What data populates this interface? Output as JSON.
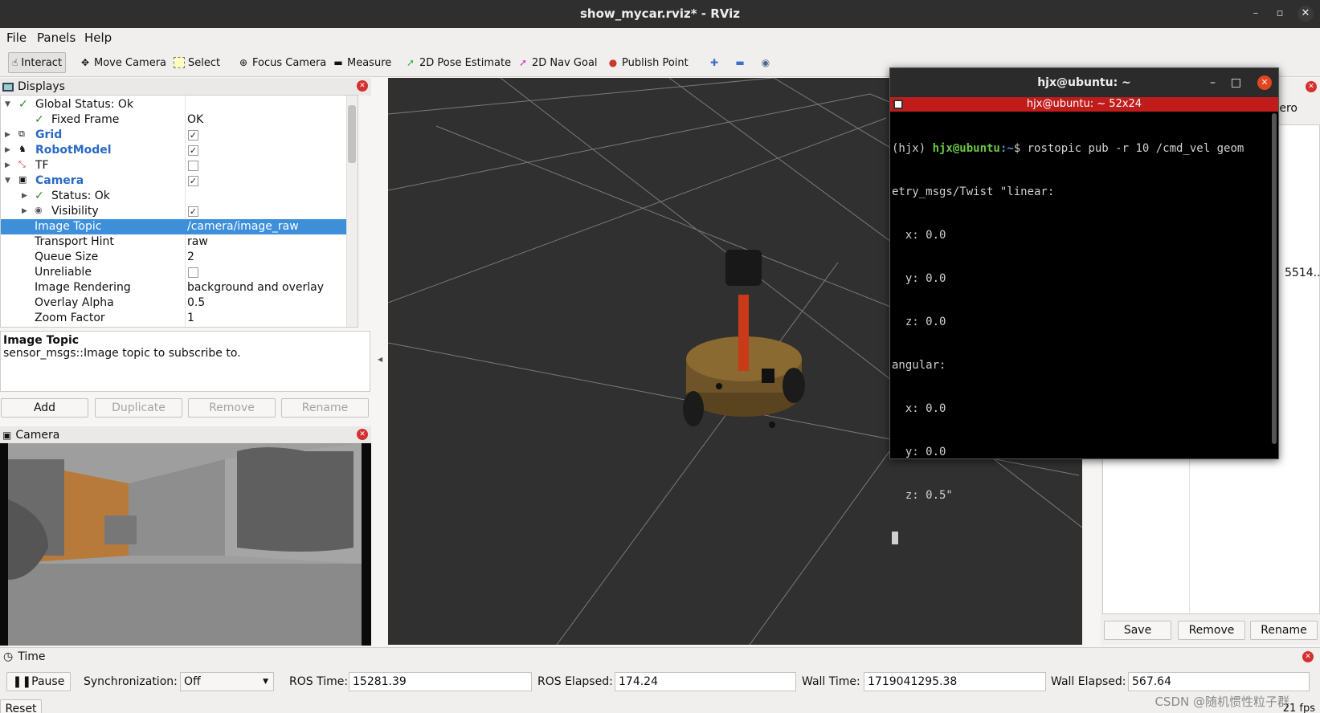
{
  "window": {
    "title": "show_mycar.rviz* - RViz"
  },
  "menu": [
    "File",
    "Panels",
    "Help"
  ],
  "toolbar": {
    "interact": "Interact",
    "move_camera": "Move Camera",
    "select": "Select",
    "focus_camera": "Focus Camera",
    "measure": "Measure",
    "pose_estimate": "2D Pose Estimate",
    "nav_goal": "2D Nav Goal",
    "publish_point": "Publish Point"
  },
  "displays": {
    "title": "Displays",
    "rows": [
      {
        "name": "Global Status: Ok",
        "value": ""
      },
      {
        "name": "Fixed Frame",
        "value": "OK"
      },
      {
        "name": "Grid",
        "value": ""
      },
      {
        "name": "RobotModel",
        "value": ""
      },
      {
        "name": "TF",
        "value": ""
      },
      {
        "name": "Camera",
        "value": ""
      },
      {
        "name": "Status: Ok",
        "value": ""
      },
      {
        "name": "Visibility",
        "value": ""
      },
      {
        "name": "Image Topic",
        "value": "/camera/image_raw"
      },
      {
        "name": "Transport Hint",
        "value": "raw"
      },
      {
        "name": "Queue Size",
        "value": "2"
      },
      {
        "name": "Unreliable",
        "value": ""
      },
      {
        "name": "Image Rendering",
        "value": "background and overlay"
      },
      {
        "name": "Overlay Alpha",
        "value": "0.5"
      },
      {
        "name": "Zoom Factor",
        "value": "1"
      }
    ],
    "checks": {
      "grid": true,
      "robotmodel": true,
      "tf": false,
      "camera": true,
      "visibility": true,
      "unreliable": false
    }
  },
  "description": {
    "title": "Image Topic",
    "text": "sensor_msgs::Image topic to subscribe to."
  },
  "display_buttons": {
    "add": "Add",
    "duplicate": "Duplicate",
    "remove": "Remove",
    "rename": "Rename"
  },
  "camera_panel": {
    "title": "Camera"
  },
  "terminal": {
    "window_title": "hjx@ubuntu: ~",
    "tab_title": "hjx@ubuntu: ~ 52x24",
    "prompt_env": "(hjx) ",
    "prompt_user": "hjx@ubuntu",
    "prompt_path": ":~",
    "prompt_cmd": "$ rostopic pub -r 10 /cmd_vel geom",
    "lines": [
      "etry_msgs/Twist \"linear:",
      "  x: 0.0",
      "  y: 0.0",
      "  z: 0.0",
      "angular:",
      "  x: 0.0",
      "  y: 0.0",
      "  z: 0.5\""
    ]
  },
  "right_panel": {
    "partial_label": "ero",
    "partial_value": "5514...",
    "save": "Save",
    "remove": "Remove",
    "rename": "Rename"
  },
  "time_panel": {
    "title": "Time",
    "pause": "Pause",
    "sync_label": "Synchronization:",
    "sync_value": "Off",
    "ros_time_label": "ROS Time:",
    "ros_time": "15281.39",
    "ros_elapsed_label": "ROS Elapsed:",
    "ros_elapsed": "174.24",
    "wall_time_label": "Wall Time:",
    "wall_time": "1719041295.38",
    "wall_elapsed_label": "Wall Elapsed:",
    "wall_elapsed": "567.64",
    "reset": "Reset",
    "fps": "21 fps",
    "watermark": "CSDN @随机惯性粒子群"
  }
}
